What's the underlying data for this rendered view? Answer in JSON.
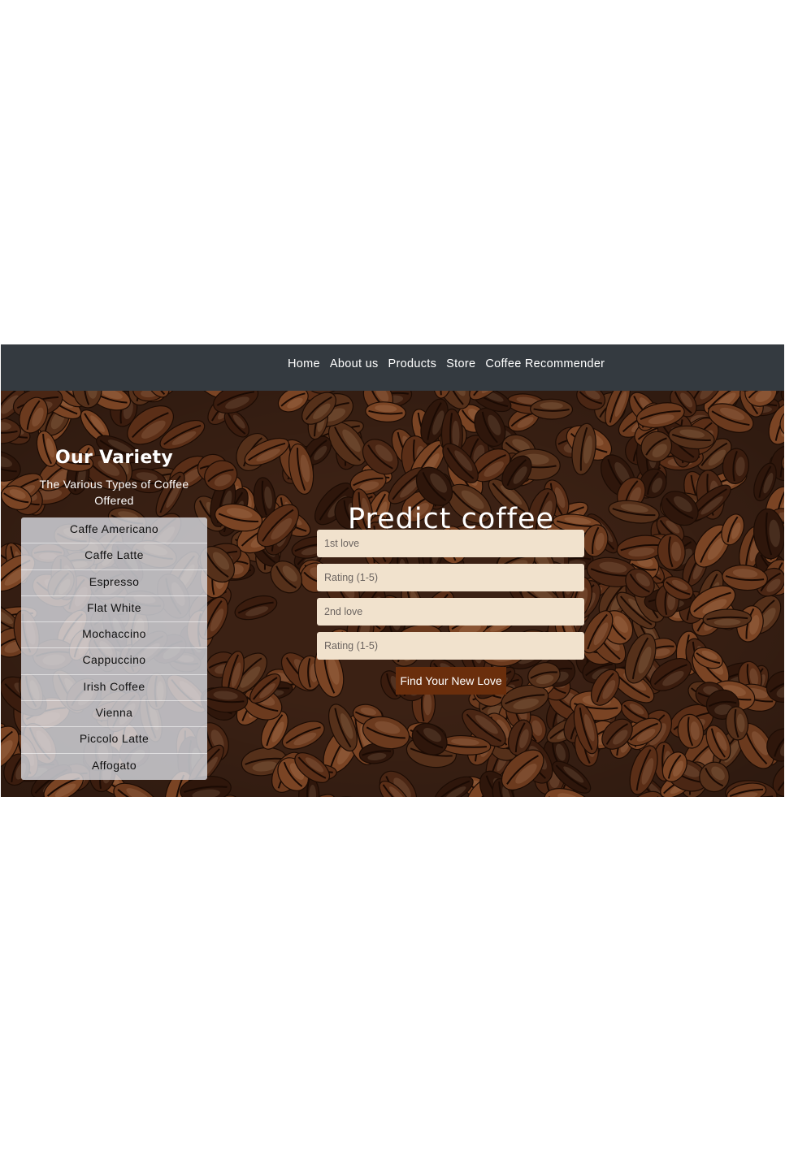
{
  "nav": {
    "links": [
      "Home",
      "About us",
      "Products",
      "Store",
      "Coffee Recommender"
    ]
  },
  "variety": {
    "title": "Our Variety",
    "subtitle": "The Various Types of Coffee Offered",
    "items": [
      "Caffe Americano",
      "Caffe Latte",
      "Espresso",
      "Flat White",
      "Mochaccino",
      "Cappuccino",
      "Irish Coffee",
      "Vienna",
      "Piccolo Latte",
      "Affogato"
    ]
  },
  "predict": {
    "title": "Predict coffee",
    "fields": [
      {
        "placeholder": "1st love",
        "value": ""
      },
      {
        "placeholder": "Rating (1-5)",
        "value": ""
      },
      {
        "placeholder": "2nd love",
        "value": ""
      },
      {
        "placeholder": "Rating (1-5)",
        "value": ""
      }
    ],
    "submit_label": "Find Your New Love"
  },
  "colors": {
    "navbar": "#343a40",
    "button": "#6a2e0c",
    "input_bg": "#f1e2cd",
    "list_bg": "#dee2e9"
  },
  "icons": {
    "background": "coffee-beans-image"
  }
}
